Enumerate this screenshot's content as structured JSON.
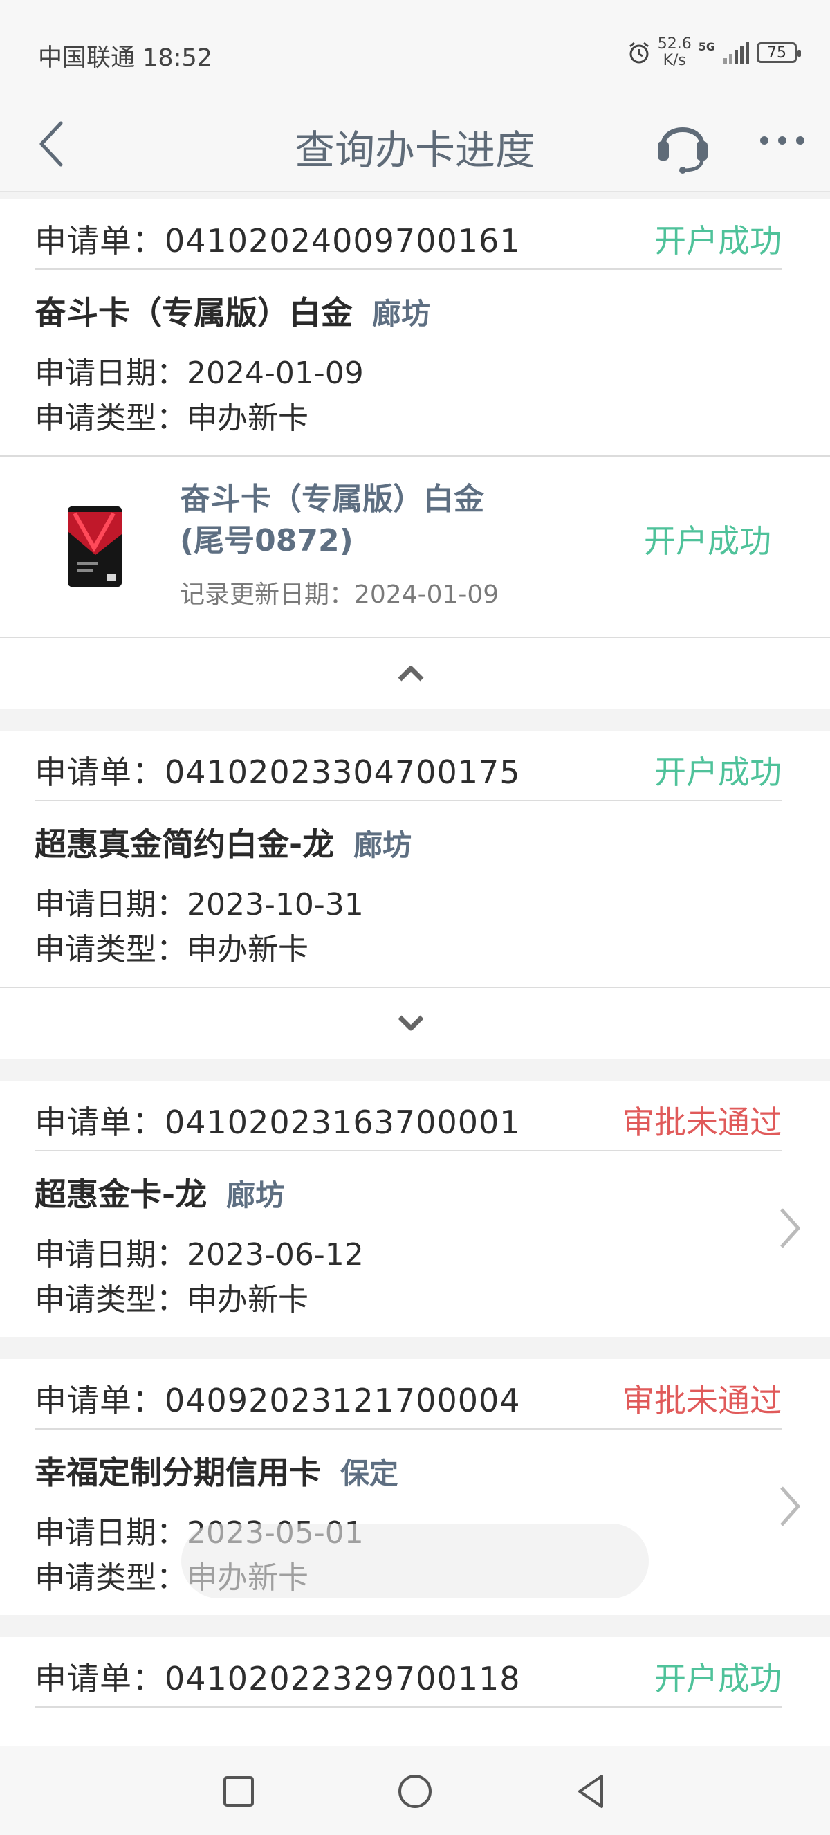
{
  "status_bar": {
    "carrier_time": "中国联通 18:52",
    "net_speed_value": "52.6",
    "net_speed_unit": "K/s",
    "network_type": "5G",
    "battery": "75"
  },
  "nav": {
    "title": "查询办卡进度"
  },
  "applications": [
    {
      "app_no": "申请单：04102024009700161",
      "status": "开户成功",
      "card_name": "奋斗卡（专属版）白金",
      "city": "廊坊",
      "apply_date": "申请日期：2024-01-09",
      "apply_type": "申请类型：申办新卡",
      "detail": {
        "title_line1": "奋斗卡（专属版）白金",
        "title_line2": "(尾号0872)",
        "update_date": "记录更新日期：2024-01-09",
        "status": "开户成功"
      }
    },
    {
      "app_no": "申请单：04102023304700175",
      "status": "开户成功",
      "card_name": "超惠真金简约白金-龙",
      "city": "廊坊",
      "apply_date": "申请日期：2023-10-31",
      "apply_type": "申请类型：申办新卡"
    },
    {
      "app_no": "申请单：04102023163700001",
      "status": "审批未通过",
      "card_name": "超惠金卡-龙",
      "city": "廊坊",
      "apply_date": "申请日期：2023-06-12",
      "apply_type": "申请类型：申办新卡"
    },
    {
      "app_no": "申请单：04092023121700004",
      "status": "审批未通过",
      "card_name": "幸福定制分期信用卡",
      "city": "保定",
      "apply_date": "申请日期：2023-05-01",
      "apply_type": "申请类型：申办新卡"
    },
    {
      "app_no": "申请单：04102022329700118",
      "status": "开户成功"
    }
  ],
  "colors": {
    "success": "#4fc29a",
    "fail": "#e05a5a",
    "title": "#5f6b78",
    "city": "#5e6f82"
  }
}
